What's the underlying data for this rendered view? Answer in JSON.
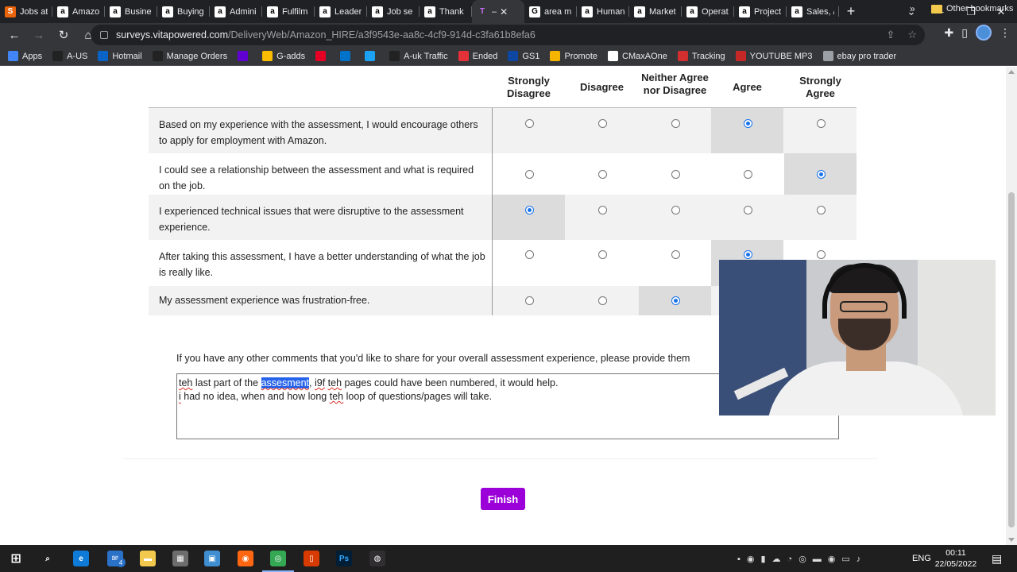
{
  "browser": {
    "tabs": [
      {
        "label": "Jobs at",
        "favicon": "S",
        "color": "#e8630a"
      },
      {
        "label": "Amazo",
        "favicon": "a",
        "color": "#ffffff"
      },
      {
        "label": "Busine",
        "favicon": "a",
        "color": "#ffffff"
      },
      {
        "label": "Buying",
        "favicon": "a",
        "color": "#ffffff"
      },
      {
        "label": "Admini",
        "favicon": "a",
        "color": "#ffffff"
      },
      {
        "label": "Fulfilm",
        "favicon": "a",
        "color": "#ffffff"
      },
      {
        "label": "Leader",
        "favicon": "a",
        "color": "#ffffff"
      },
      {
        "label": "Job se",
        "favicon": "a",
        "color": "#ffffff"
      },
      {
        "label": "Thank",
        "favicon": "a",
        "color": "#ffffff"
      },
      {
        "label": "–",
        "favicon": "T",
        "color": "#9b00d9"
      },
      {
        "label": "area m",
        "favicon": "G",
        "color": "#ffffff"
      },
      {
        "label": "Human",
        "favicon": "a",
        "color": "#ffffff"
      },
      {
        "label": "Market",
        "favicon": "a",
        "color": "#ffffff"
      },
      {
        "label": "Operat",
        "favicon": "a",
        "color": "#ffffff"
      },
      {
        "label": "Project",
        "favicon": "a",
        "color": "#ffffff"
      },
      {
        "label": "Sales, /",
        "favicon": "a",
        "color": "#ffffff"
      }
    ],
    "active_tab_index": 9,
    "url_host": "surveys.vitapowered.com",
    "url_path": "/DeliveryWeb/Amazon_HIRE/a3f9543e-aa8c-4cf9-914d-c3fa61b8efa6",
    "bookmarks": [
      {
        "label": "Apps",
        "icon": "apps-grid-icon",
        "color": "#4285f4"
      },
      {
        "label": "A-US",
        "icon": "amazon-icon",
        "color": "#222222"
      },
      {
        "label": "Hotmail",
        "icon": "outlook-icon",
        "color": "#0a64c8"
      },
      {
        "label": "Manage Orders",
        "icon": "amazon-icon",
        "color": "#222222"
      },
      {
        "label": "",
        "icon": "yahoo-icon",
        "color": "#6001d2"
      },
      {
        "label": "G-adds",
        "icon": "google-ads-icon",
        "color": "#fbbc04"
      },
      {
        "label": "",
        "icon": "pinterest-icon",
        "color": "#e60023"
      },
      {
        "label": "",
        "icon": "sky-icon",
        "color": "#0072c9"
      },
      {
        "label": "",
        "icon": "image-icon",
        "color": "#1da1f2"
      },
      {
        "label": "A-uk Traffic",
        "icon": "amazon-icon",
        "color": "#222222"
      },
      {
        "label": "Ended",
        "icon": "ebay-icon",
        "color": "#e53238"
      },
      {
        "label": "GS1",
        "icon": "gs1-icon",
        "color": "#0d47a1"
      },
      {
        "label": "Promote",
        "icon": "promote-icon",
        "color": "#f4b400"
      },
      {
        "label": "CMaxAOne",
        "icon": "cmax-icon",
        "color": "#ffffff"
      },
      {
        "label": "Tracking",
        "icon": "tracking-icon",
        "color": "#d32f2f"
      },
      {
        "label": "YOUTUBE MP3",
        "icon": "youtube-mp3-icon",
        "color": "#c62828"
      },
      {
        "label": "ebay pro trader",
        "icon": "globe-icon",
        "color": "#9aa0a6"
      }
    ],
    "bookmarks_more": "»",
    "other_bookmarks": "Other bookmarks"
  },
  "survey": {
    "scale_headers": [
      {
        "label": "Strongly Disagree"
      },
      {
        "label": "Disagree"
      },
      {
        "label": "Neither Agree nor Disagree"
      },
      {
        "label": "Agree"
      },
      {
        "label": "Strongly Agree"
      }
    ],
    "rows": [
      {
        "statement": "Based on my experience with the assessment, I would encourage others to apply for employment with Amazon.",
        "selected": 3
      },
      {
        "statement": "I could see a relationship between the assessment and what is required on the job.",
        "selected": 4
      },
      {
        "statement": "I experienced technical issues that were disruptive to the assessment experience.",
        "selected": 0
      },
      {
        "statement": "After taking this assessment, I have a better understanding of what the job is really like.",
        "selected": 3
      },
      {
        "statement": "My assessment experience was frustration-free.",
        "selected": 2
      }
    ],
    "comment_question": "If you have any other comments that you'd like to share for your overall assessment experience, please provide them",
    "comment_value": "teh last part of the assesment, i9f teh pages could have been numbered, it would help.\ni had no idea, when and how long teh loop of questions/pages will take.",
    "finish_label": "Finish",
    "accent_color": "#9b00d9",
    "radio_color": "#1a73e8"
  },
  "taskbar": {
    "apps": [
      "windows-start-icon",
      "search-icon",
      "edge-icon",
      "mail-icon",
      "file-explorer-icon",
      "calculator-icon",
      "store-icon",
      "firefox-icon",
      "chrome-icon",
      "office-icon",
      "photoshop-icon",
      "obs-icon"
    ],
    "mail_badge": "4",
    "language": "ENG",
    "time": "00:11",
    "date": "22/05/2022"
  }
}
